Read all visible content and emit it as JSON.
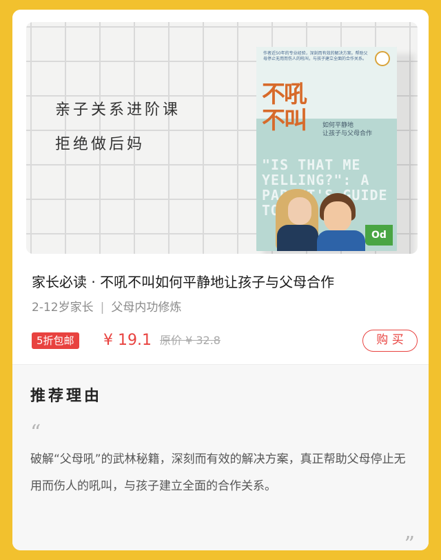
{
  "hero": {
    "line1": "亲子关系进阶课",
    "line2": "拒绝做后妈",
    "book": {
      "blurb": "作者近50年的专业经验，深刻而有效的解决方案。帮助父母停止无用而伤人的吼叫，与孩子建立全面的合作关系。",
      "title_big": "不吼\n不叫",
      "subtitle_line1": "如何平静地",
      "subtitle_line2": "让孩子与父母合作",
      "quote_en": "\"IS THAT ME YELLING?\": A PARENT'S GUIDE TO ...",
      "badge": "Od"
    }
  },
  "product": {
    "title": "家长必读 · 不吼不叫如何平静地让孩子与父母合作",
    "age": "2-12岁家长",
    "separator": "|",
    "category": "父母内功修炼",
    "badge": "5折包邮",
    "price": "¥ 19.1",
    "original_price": "原价 ¥ 32.8",
    "buy_label": "购 买"
  },
  "reason": {
    "title": "推荐理由",
    "quote_open": "“",
    "text": "破解“父母吼”的武林秘籍，深刻而有效的解决方案，真正帮助父母停止无用而伤人的吼叫，与孩子建立全面的合作关系。",
    "quote_close": "”"
  },
  "colors": {
    "background": "#f2c12e",
    "accent": "#e8423f"
  }
}
